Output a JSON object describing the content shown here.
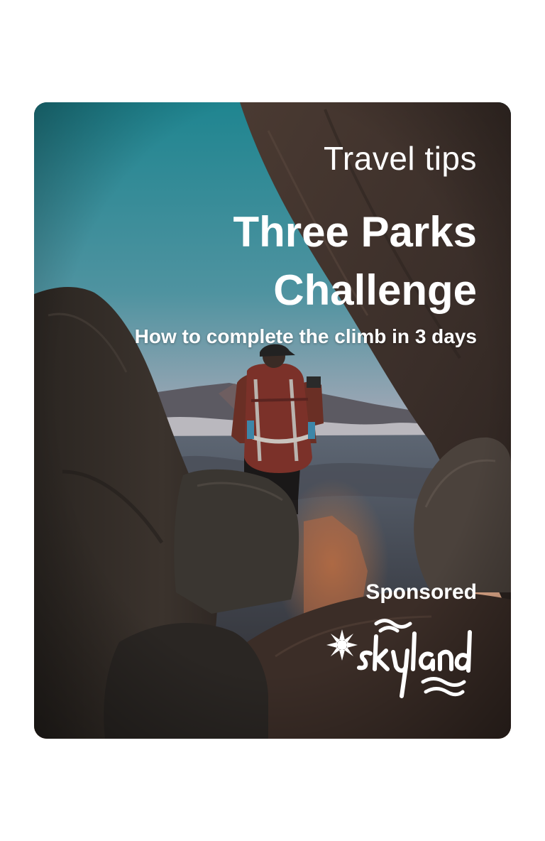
{
  "card": {
    "category": "Travel tips",
    "title": "Three Parks Challenge",
    "subtitle": "How to complete the climb in 3 days",
    "sponsored_label": "Sponsored",
    "brand_logo_text": "skyland"
  },
  "colors": {
    "sky_top": "#2a8c92",
    "sky_horizon": "#e6a58c",
    "rock_dark": "#2b2420",
    "rock_brown": "#5a4233",
    "text": "#ffffff"
  },
  "icons": {
    "logo_mark": "sun-flower-icon",
    "logo_waves": "waves-icon"
  }
}
